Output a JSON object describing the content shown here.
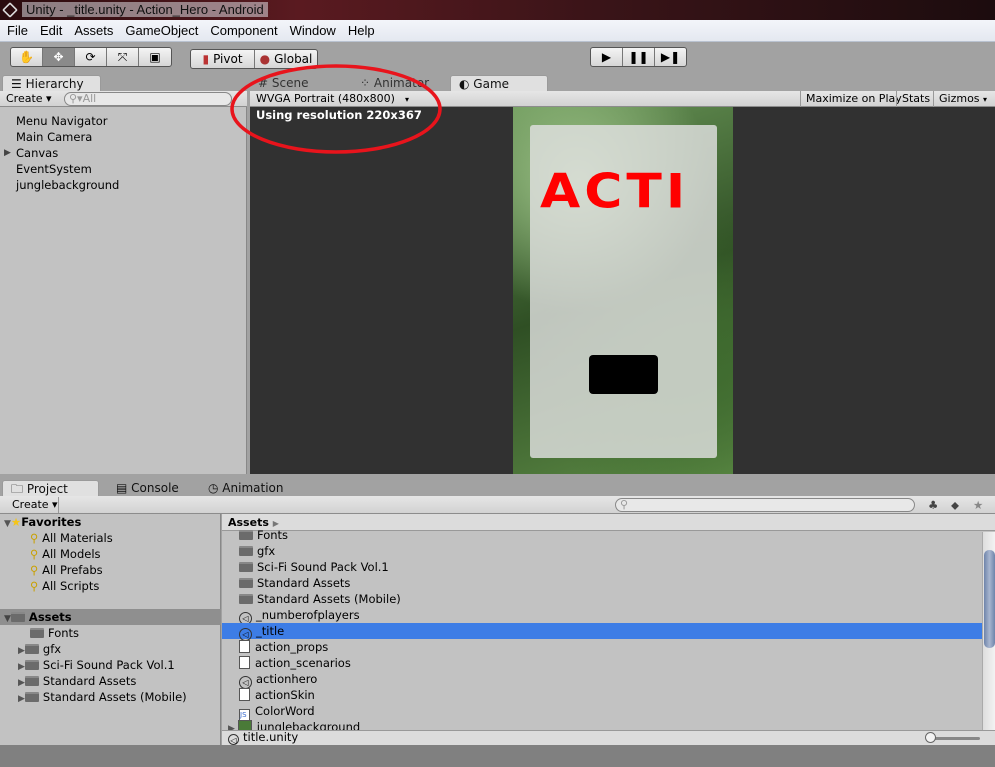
{
  "window": {
    "title": "Unity - _title.unity - Action_Hero - Android"
  },
  "menu": [
    "File",
    "Edit",
    "Assets",
    "GameObject",
    "Component",
    "Window",
    "Help"
  ],
  "toolbar": {
    "pivot": "Pivot",
    "global": "Global",
    "tools": [
      "hand-icon",
      "move-icon",
      "rotate-icon",
      "scale-icon",
      "rect-icon"
    ],
    "play": [
      "play-icon",
      "pause-icon",
      "step-icon"
    ]
  },
  "hierarchy": {
    "tab": "Hierarchy",
    "create": "Create",
    "search_placeholder": "All",
    "items": [
      "Menu Navigator",
      "Main Camera",
      "Canvas",
      "EventSystem",
      "junglebackground"
    ]
  },
  "center_tabs": [
    "Scene",
    "Animator",
    "Game"
  ],
  "game": {
    "resolution_select": "WVGA Portrait (480x800)",
    "resolution_info": "Using resolution 220x367",
    "maximize": "Maximize on Play",
    "stats": "Stats",
    "gizmos": "Gizmos",
    "title_text": "ACTI",
    "annotation_color": "#e8141c"
  },
  "bottom_tabs": [
    "Project",
    "Console",
    "Animation"
  ],
  "project": {
    "create": "Create",
    "favorites_label": "Favorites",
    "favorites": [
      "All Materials",
      "All Models",
      "All Prefabs",
      "All Scripts"
    ],
    "assets_label": "Assets",
    "tree": [
      "Fonts",
      "gfx",
      "Sci-Fi Sound Pack Vol.1",
      "Standard Assets",
      "Standard Assets (Mobile)"
    ],
    "breadcrumb": "Assets",
    "files": [
      {
        "name": "Fonts",
        "type": "folder"
      },
      {
        "name": "gfx",
        "type": "folder"
      },
      {
        "name": "Sci-Fi Sound Pack Vol.1",
        "type": "folder"
      },
      {
        "name": "Standard Assets",
        "type": "folder"
      },
      {
        "name": "Standard Assets (Mobile)",
        "type": "folder"
      },
      {
        "name": "_numberofplayers",
        "type": "scene"
      },
      {
        "name": "_title",
        "type": "scene",
        "selected": true
      },
      {
        "name": "action_props",
        "type": "text"
      },
      {
        "name": "action_scenarios",
        "type": "text"
      },
      {
        "name": "actionhero",
        "type": "scene"
      },
      {
        "name": "actionSkin",
        "type": "skin"
      },
      {
        "name": "ColorWord",
        "type": "script"
      },
      {
        "name": "junglebackground",
        "type": "texture"
      }
    ],
    "selected_path": "title.unity",
    "selection_color": "#3d7de6"
  }
}
